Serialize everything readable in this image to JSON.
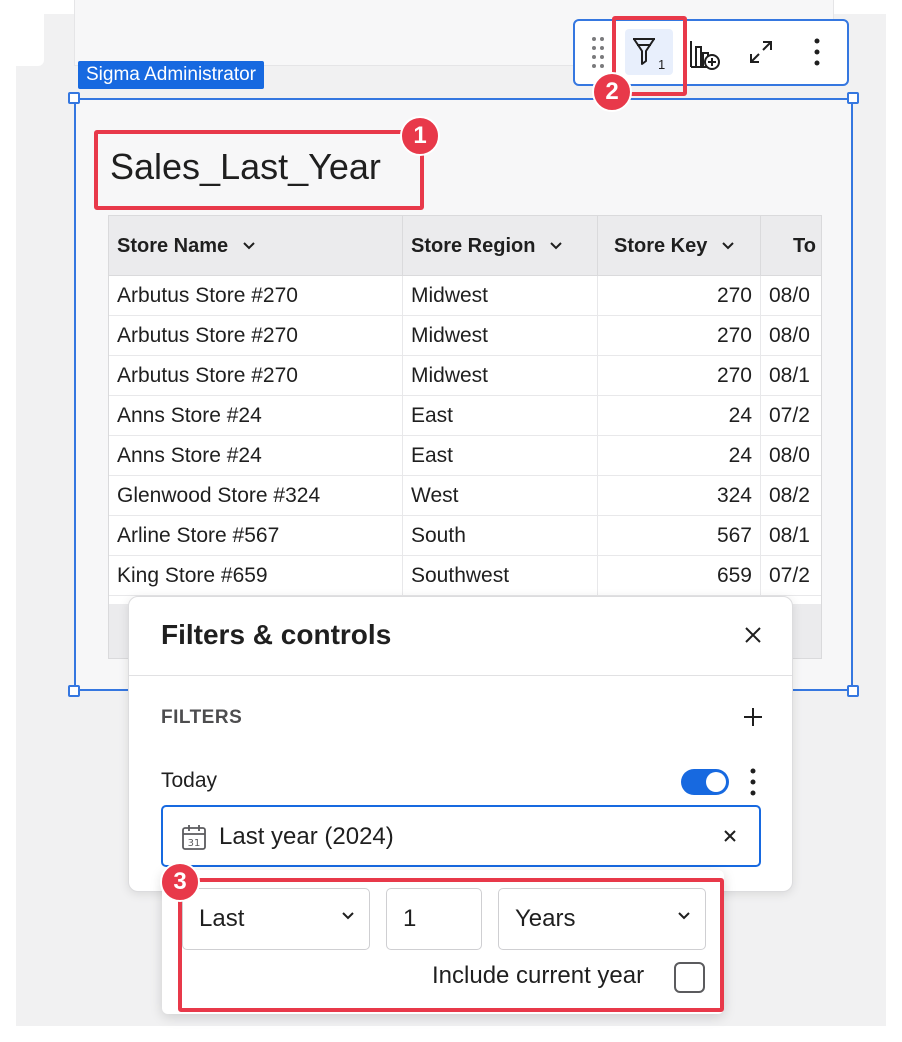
{
  "role_badge": "Sigma Administrator",
  "toolbar": {
    "filter_count": "1",
    "icons": [
      "drag-handle-icon",
      "filter-icon",
      "add-chart-icon",
      "expand-icon",
      "more-vertical-icon"
    ]
  },
  "element": {
    "title": "Sales_Last_Year"
  },
  "table": {
    "columns": [
      "Store Name",
      "Store Region",
      "Store Key",
      "To"
    ],
    "rows": [
      [
        "Arbutus Store #270",
        "Midwest",
        "270",
        "08/0"
      ],
      [
        "Arbutus Store #270",
        "Midwest",
        "270",
        "08/0"
      ],
      [
        "Arbutus Store #270",
        "Midwest",
        "270",
        "08/1"
      ],
      [
        "Anns Store #24",
        "East",
        "24",
        "07/2"
      ],
      [
        "Anns Store #24",
        "East",
        "24",
        "08/0"
      ],
      [
        "Glenwood Store #324",
        "West",
        "324",
        "08/2"
      ],
      [
        "Arline Store #567",
        "South",
        "567",
        "08/1"
      ],
      [
        "King Store #659",
        "Southwest",
        "659",
        "07/2"
      ]
    ]
  },
  "filters_panel": {
    "title": "Filters & controls",
    "section_label": "FILTERS",
    "filter": {
      "name": "Today",
      "enabled": true,
      "value": "Last year (2024)"
    }
  },
  "relative_date": {
    "direction": "Last",
    "amount": "1",
    "unit": "Years",
    "include_current_label": "Include current year",
    "include_current_checked": false
  },
  "callouts": [
    "1",
    "2",
    "3"
  ],
  "colors": {
    "accent": "#1769e0",
    "callout": "#e8394a",
    "selection_border": "#3577e0"
  }
}
